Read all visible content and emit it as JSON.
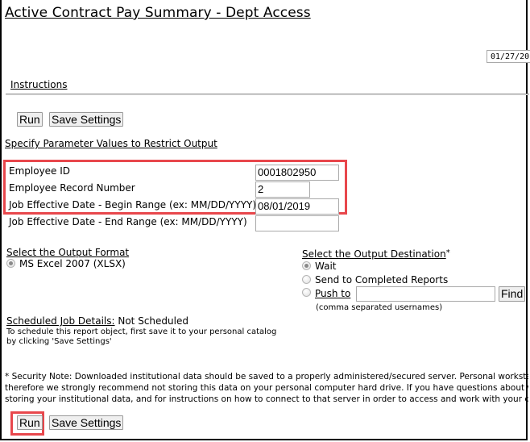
{
  "header": {
    "title": "Active Contract Pay Summary - Dept Access",
    "date_value": "01/27/20"
  },
  "nav": {
    "instructions_link": "Instructions"
  },
  "toolbar_top": {
    "run_label": "Run",
    "save_settings_label": "Save Settings"
  },
  "parameters": {
    "section_title": "Specify Parameter Values to Restrict Output",
    "fields": [
      {
        "label": "Employee ID",
        "value": "0001802950"
      },
      {
        "label": "Employee Record Number",
        "value": "2"
      },
      {
        "label": "Job Effective Date - Begin Range (ex: MM/DD/YYYY)",
        "value": "08/01/2019"
      },
      {
        "label": "Job Effective Date - End Range (ex: MM/DD/YYYY)",
        "value": ""
      }
    ]
  },
  "output_format": {
    "title": "Select the Output Format",
    "options": [
      {
        "label": "MS Excel 2007 (XLSX)",
        "selected": true
      }
    ]
  },
  "output_destination": {
    "title": "Select the Output Destination",
    "required_mark": "*",
    "options": [
      {
        "label": "Wait",
        "selected": true
      },
      {
        "label": "Send to Completed Reports",
        "selected": false
      },
      {
        "label": "Push to",
        "selected": false
      }
    ],
    "push_to_value": "",
    "find_label": "Find",
    "push_hint": "(comma separated usernames)"
  },
  "schedule": {
    "title": "Scheduled Job Details:",
    "status": "Not Scheduled",
    "help_line1": "To schedule this report object, first save it to your personal catalog",
    "help_line2": "by clicking 'Save Settings'"
  },
  "security_note": {
    "label": "* Security Note:",
    "line1": "Downloaded institutional data should be saved to a properly administered/secured server. Personal workstations may n",
    "line2": "therefore we strongly recommend not storing this data on your personal computer hard drive. If you have questions about whether or n",
    "line3": "storing your institutional data, and for instructions on how to connect to that server in order to access and work with your data, please"
  },
  "toolbar_bottom": {
    "run_label": "Run",
    "save_settings_label": "Save Settings"
  },
  "highlight_color": "#e8474c"
}
